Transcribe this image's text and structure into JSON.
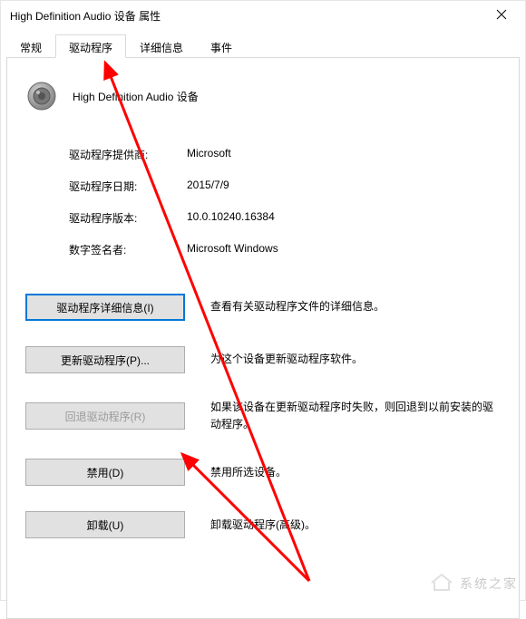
{
  "window": {
    "title": "High Definition Audio 设备 属性"
  },
  "tabs": {
    "general": "常规",
    "driver": "驱动程序",
    "details": "详细信息",
    "events": "事件",
    "active_index": 1
  },
  "device": {
    "name": "High Definition Audio 设备"
  },
  "info": {
    "provider_label": "驱动程序提供商:",
    "provider_value": "Microsoft",
    "date_label": "驱动程序日期:",
    "date_value": "2015/7/9",
    "version_label": "驱动程序版本:",
    "version_value": "10.0.10240.16384",
    "signer_label": "数字签名者:",
    "signer_value": "Microsoft Windows"
  },
  "actions": {
    "details_btn": "驱动程序详细信息(I)",
    "details_desc": "查看有关驱动程序文件的详细信息。",
    "update_btn": "更新驱动程序(P)...",
    "update_desc": "为这个设备更新驱动程序软件。",
    "rollback_btn": "回退驱动程序(R)",
    "rollback_desc": "如果该设备在更新驱动程序时失败，则回退到以前安装的驱动程序。",
    "disable_btn": "禁用(D)",
    "disable_desc": "禁用所选设备。",
    "uninstall_btn": "卸载(U)",
    "uninstall_desc": "卸载驱动程序(高级)。"
  },
  "watermark": {
    "text": "系统之家"
  }
}
